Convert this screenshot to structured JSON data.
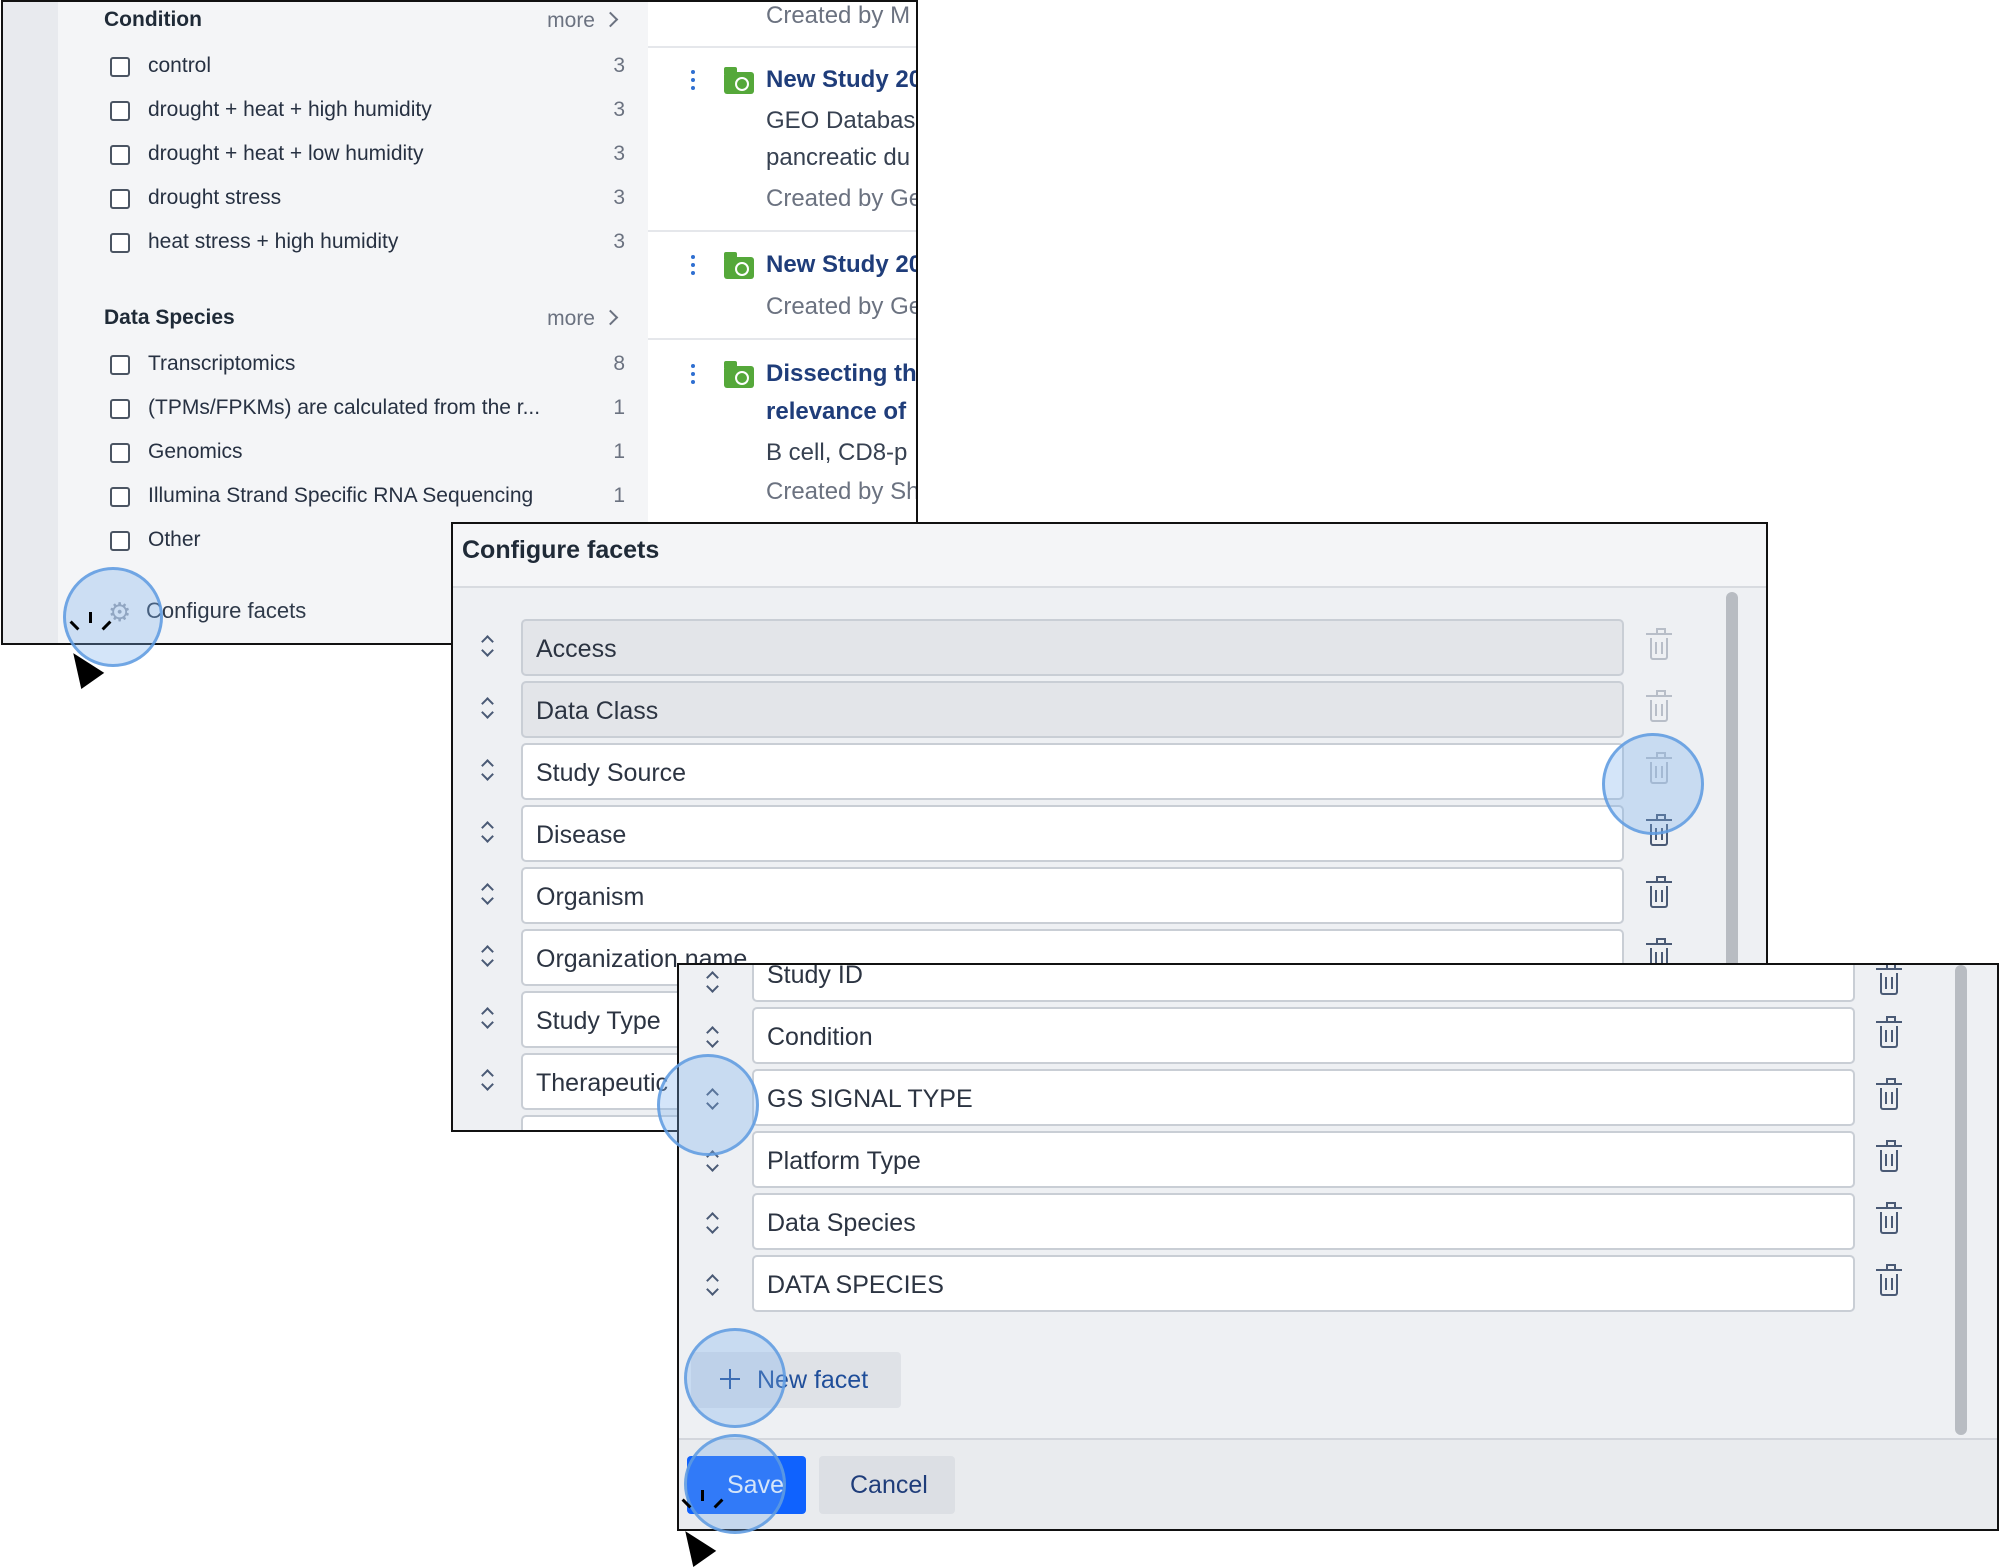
{
  "filters": {
    "condition": {
      "heading": "Condition",
      "more": "more",
      "items": [
        {
          "label": "control",
          "count": "3"
        },
        {
          "label": "drought + heat + high humidity",
          "count": "3"
        },
        {
          "label": "drought + heat + low humidity",
          "count": "3"
        },
        {
          "label": "drought stress",
          "count": "3"
        },
        {
          "label": "heat stress + high humidity",
          "count": "3"
        }
      ]
    },
    "data_species": {
      "heading": "Data Species",
      "more": "more",
      "items": [
        {
          "label": "Transcriptomics",
          "count": "8"
        },
        {
          "label": "(TPMs/FPKMs) are calculated from the r...",
          "count": "1"
        },
        {
          "label": "Genomics",
          "count": "1"
        },
        {
          "label": "Illumina Strand Specific RNA Sequencing",
          "count": "1"
        },
        {
          "label": "Other",
          "count": ""
        }
      ]
    },
    "configure_label": "Configure facets"
  },
  "results": [
    {
      "meta_top": "Created by M"
    },
    {
      "title": "New Study 20",
      "lines": [
        "GEO Databas",
        "pancreatic du"
      ],
      "meta": "Created by Ge"
    },
    {
      "title": "New Study 20",
      "meta": "Created by Ge"
    },
    {
      "title_lines": [
        "Dissecting th",
        "relevance of"
      ],
      "lines": [
        "B cell, CD8-p"
      ],
      "meta": "Created by Sh"
    }
  ],
  "dialog": {
    "title": "Configure facets",
    "facets": [
      {
        "label": "Access",
        "locked": true
      },
      {
        "label": "Data Class",
        "locked": true
      },
      {
        "label": "Study Source",
        "locked": false
      },
      {
        "label": "Disease",
        "locked": false
      },
      {
        "label": "Organism",
        "locked": false
      },
      {
        "label": "Organization name",
        "locked": false
      },
      {
        "label": "Study Type",
        "locked": false
      },
      {
        "label": "Therapeutic",
        "locked": false
      }
    ]
  },
  "dialog_continued": {
    "facets": [
      {
        "label": "Study ID"
      },
      {
        "label": "Condition"
      },
      {
        "label": "GS SIGNAL TYPE"
      },
      {
        "label": "Platform Type"
      },
      {
        "label": "Data Species"
      },
      {
        "label": "DATA SPECIES"
      }
    ],
    "new_facet_label": "New facet",
    "save_label": "Save",
    "cancel_label": "Cancel"
  },
  "colors": {
    "primary": "#0f62fe",
    "link": "#1f3d7a",
    "folder": "#55a83a",
    "highlight": "#78afeb"
  }
}
